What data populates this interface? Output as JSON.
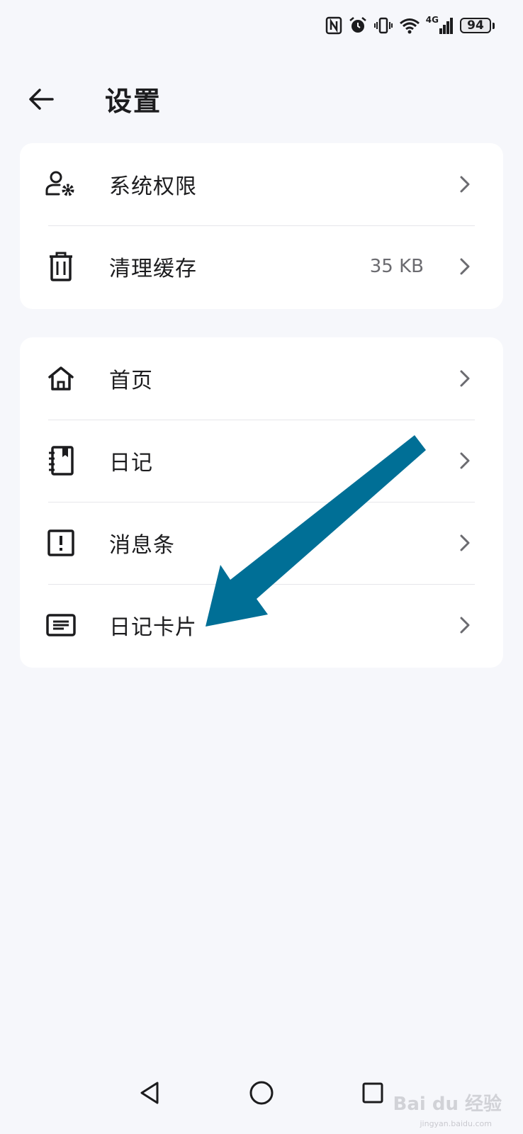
{
  "status_bar": {
    "icons": [
      "nfc-icon",
      "alarm-icon",
      "vibrate-icon",
      "wifi-icon",
      "signal-4g-icon"
    ],
    "network_label": "4G",
    "battery_level": "94"
  },
  "header": {
    "title": "设置"
  },
  "sections": [
    {
      "items": [
        {
          "icon": "user-settings-icon",
          "label": "系统权限",
          "value": ""
        },
        {
          "icon": "trash-icon",
          "label": "清理缓存",
          "value": "35 KB"
        }
      ]
    },
    {
      "items": [
        {
          "icon": "home-icon",
          "label": "首页",
          "value": ""
        },
        {
          "icon": "diary-icon",
          "label": "日记",
          "value": ""
        },
        {
          "icon": "alert-box-icon",
          "label": "消息条",
          "value": ""
        },
        {
          "icon": "card-icon",
          "label": "日记卡片",
          "value": ""
        }
      ]
    }
  ],
  "annotation": {
    "color": "#006f96"
  },
  "watermark": {
    "text": "Bai du 经验",
    "sub": "jingyan.baidu.com"
  }
}
